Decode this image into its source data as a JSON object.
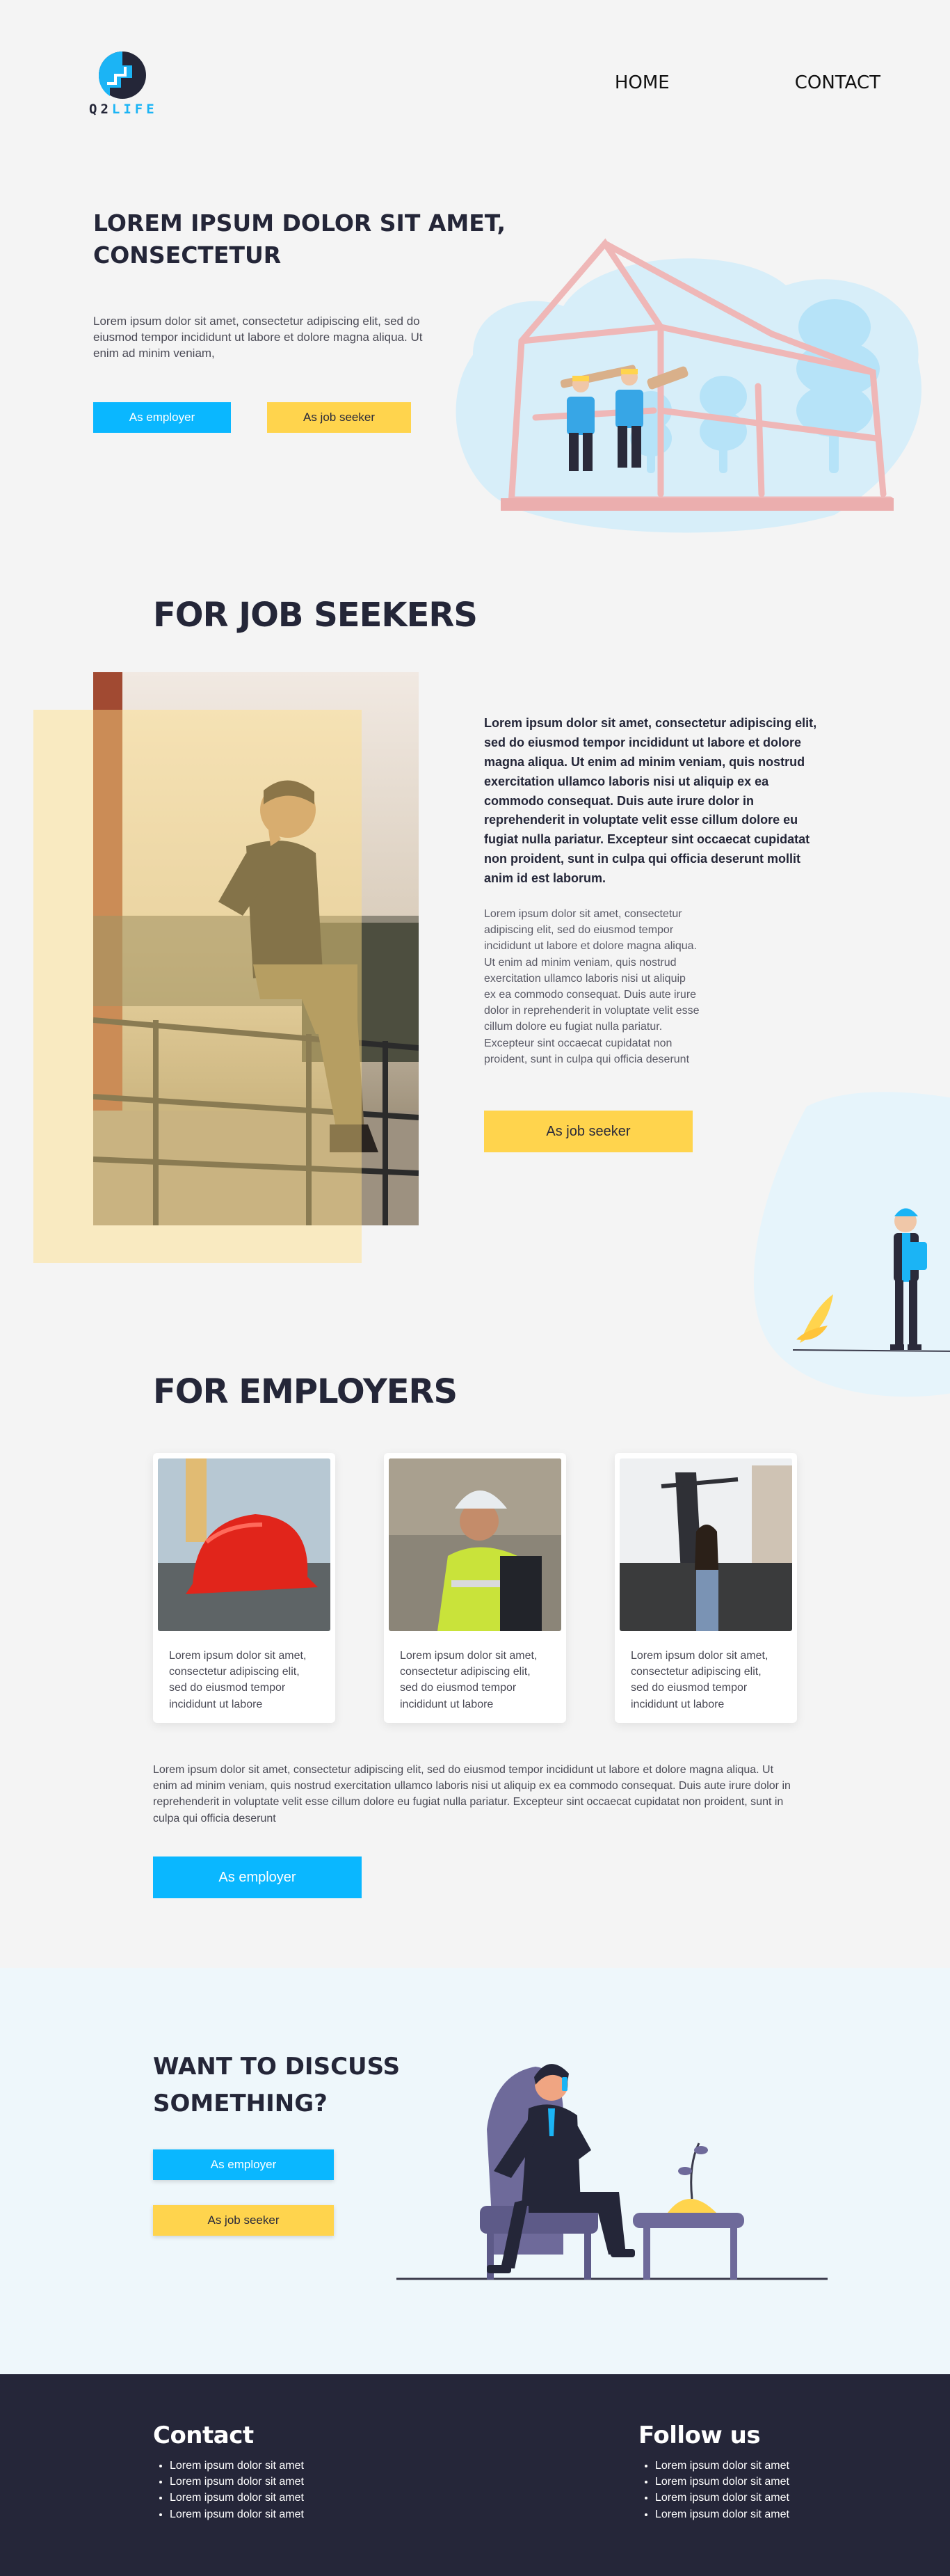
{
  "header": {
    "logo_prefix": "Q2",
    "logo_suffix": "LIFE",
    "nav": {
      "home": "HOME",
      "contact": "CONTACT"
    }
  },
  "hero": {
    "title": "LOREM IPSUM DOLOR SIT AMET, CONSECTETUR",
    "text": "Lorem ipsum dolor sit amet, consectetur adipiscing elit, sed do eiusmod tempor incididunt ut labore et dolore magna aliqua. Ut enim ad minim veniam,",
    "btn_employer": "As employer",
    "btn_seeker": "As job seeker"
  },
  "job_seekers": {
    "title": "FOR JOB SEEKERS",
    "bold_text": "Lorem ipsum dolor sit amet, consectetur adipiscing elit, sed do eiusmod tempor incididunt ut labore et dolore magna aliqua. Ut enim ad minim veniam, quis nostrud exercitation ullamco laboris nisi ut aliquip ex ea commodo consequat. Duis aute irure dolor in reprehenderit in voluptate velit esse cillum dolore eu fugiat nulla pariatur. Excepteur sint occaecat cupidatat non proident, sunt in culpa qui officia deserunt mollit anim id est laborum.",
    "text": "Lorem ipsum dolor sit amet, consectetur adipiscing elit, sed do eiusmod tempor incididunt ut labore et dolore magna aliqua. Ut enim ad minim veniam, quis nostrud exercitation ullamco laboris nisi ut aliquip ex ea commodo consequat. Duis aute irure dolor in reprehenderit in voluptate velit esse cillum dolore eu fugiat nulla pariatur. Excepteur sint occaecat cupidatat non proident, sunt in culpa qui officia deserunt",
    "button": "As job seeker"
  },
  "employers": {
    "title": "FOR EMPLOYERS",
    "cards": [
      {
        "text": "Lorem ipsum dolor sit amet, consectetur adipiscing elit, sed do eiusmod tempor incididunt ut labore"
      },
      {
        "text": "Lorem ipsum dolor sit amet, consectetur adipiscing elit, sed do eiusmod tempor incididunt ut labore"
      },
      {
        "text": "Lorem ipsum dolor sit amet, consectetur adipiscing elit, sed do eiusmod tempor incididunt ut labore"
      }
    ],
    "text": "Lorem ipsum dolor sit amet, consectetur adipiscing elit, sed do eiusmod tempor incididunt ut labore et dolore magna aliqua. Ut enim ad minim veniam, quis nostrud exercitation ullamco laboris nisi ut aliquip ex ea commodo consequat. Duis aute irure dolor in reprehenderit in voluptate velit esse cillum dolore eu fugiat nulla pariatur. Excepteur sint occaecat cupidatat non proident, sunt in culpa qui officia deserunt",
    "button": "As employer"
  },
  "discuss": {
    "title": "WANT TO DISCUSS SOMETHING?",
    "btn_employer": "As employer",
    "btn_seeker": "As job seeker"
  },
  "footer": {
    "contact_title": "Contact",
    "contact_items": [
      "Lorem ipsum dolor sit amet",
      "Lorem ipsum dolor sit amet",
      "Lorem ipsum dolor sit amet",
      "Lorem ipsum dolor sit amet"
    ],
    "follow_title": "Follow us",
    "follow_items": [
      "Lorem ipsum dolor sit amet",
      "Lorem ipsum dolor sit amet",
      "Lorem ipsum dolor sit amet",
      "Lorem ipsum dolor sit amet"
    ]
  },
  "colors": {
    "accent_blue": "#0ab7ff",
    "accent_yellow": "#ffd44d",
    "dark_navy": "#252639",
    "background": "#f4f4f4"
  }
}
